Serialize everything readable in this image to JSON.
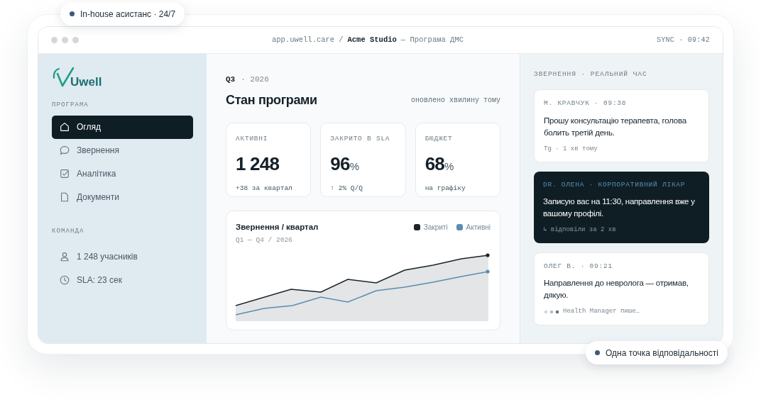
{
  "badges": [
    {
      "text": "In-house асистанс · 24/7",
      "color": "#3b5a78"
    },
    {
      "text": "Одна точка відповідальності",
      "color": "#3b5a78"
    }
  ],
  "window": {
    "address": "app.uwell.care",
    "separator": "/",
    "company": "Acme Studio",
    "suffix": "— Програма ДМС",
    "sync": "SYNC · 09:42"
  },
  "sidebar": {
    "logo": "Uwell",
    "program_heading": "ПРОГРАМА",
    "items": [
      {
        "label": "Огляд",
        "selected": true
      },
      {
        "label": "Звернення",
        "selected": false
      },
      {
        "label": "Аналітика",
        "selected": false
      },
      {
        "label": "Документи",
        "selected": false
      }
    ],
    "team_heading": "КОМАНДА",
    "team": [
      {
        "label": "1 248 учасників"
      },
      {
        "label": "SLA: 23 сек"
      }
    ]
  },
  "main": {
    "period": "Q3",
    "year": "· 2026",
    "title": "Стан програми",
    "updated": "оновлено хвилину тому",
    "stats": [
      {
        "label": "АКТИВНІ",
        "value": "1 248",
        "note": "+38 за квартал"
      },
      {
        "label": "ЗАКРИТО В SLA",
        "value": "96",
        "unit": "%",
        "note": "↑ 2% Q/Q"
      },
      {
        "label": "БЮДЖЕТ",
        "value": "68",
        "unit": "%",
        "note": "на графіку"
      }
    ],
    "chart": {
      "title": "Звернення / квартал",
      "subtitle": "Q1 — Q4 / 2026",
      "legend": [
        {
          "name": "Закриті",
          "color": "#1b2428"
        },
        {
          "name": "Активні",
          "color": "#5b8db0"
        }
      ]
    }
  },
  "feed": {
    "heading": "ЗВЕРНЕННЯ · РЕАЛЬНИЙ ЧАС",
    "messages": [
      {
        "kind": "incoming",
        "author": "М. КРАВЧУК · 09:38",
        "text": "Прошу консультацію терапевта, голова болить третій день.",
        "footer": "Tg · 1 хв тому",
        "typing": false
      },
      {
        "kind": "staff",
        "author": "DR. ОЛЕНА · КОРПОРАТИВНИЙ ЛІКАР",
        "text": "Записую вас на 11:30, направлення вже у вашому профілі.",
        "footer": "↳ відповіли за 2 хв",
        "typing": false
      },
      {
        "kind": "incoming",
        "author": "ОЛЕГ В. · 09:21",
        "text": "Направлення до невролога — отримав, дякую.",
        "footer": "Health Manager пише…",
        "typing": true
      }
    ]
  }
}
